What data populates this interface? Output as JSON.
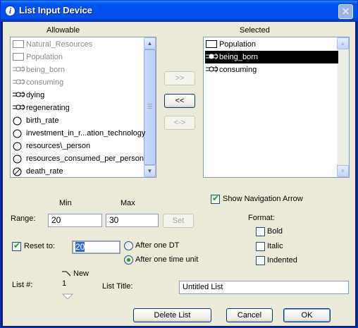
{
  "window": {
    "title": "List Input Device"
  },
  "allowable": {
    "header": "Allowable",
    "items": [
      {
        "label": "Natural_Resources",
        "icon": "stock-icon",
        "dimmed": true
      },
      {
        "label": "Population",
        "icon": "stock-icon",
        "dimmed": true
      },
      {
        "label": "being_born",
        "icon": "flow-icon",
        "dimmed": true
      },
      {
        "label": "consuming",
        "icon": "flow-icon",
        "dimmed": true
      },
      {
        "label": "dying",
        "icon": "flow-icon",
        "dimmed": false
      },
      {
        "label": "regenerating",
        "icon": "flow-icon",
        "dimmed": false
      },
      {
        "label": "birth_rate",
        "icon": "converter-icon",
        "dimmed": false
      },
      {
        "label": "investment_in_r...ation_technology",
        "icon": "converter-icon",
        "dimmed": false
      },
      {
        "label": "resources\\_person",
        "icon": "converter-icon",
        "dimmed": false
      },
      {
        "label": "resources_consumed_per_person",
        "icon": "converter-icon",
        "dimmed": false
      },
      {
        "label": "death_rate",
        "icon": "ghost-converter-icon",
        "dimmed": false
      }
    ]
  },
  "selected": {
    "header": "Selected",
    "items": [
      {
        "label": "Population",
        "icon": "stock-icon",
        "selected": false
      },
      {
        "label": "being_born",
        "icon": "flow-icon",
        "selected": true
      },
      {
        "label": "consuming",
        "icon": "flow-icon",
        "selected": false
      }
    ]
  },
  "transfer": {
    "add": ">>",
    "remove": "<<",
    "swap": "<->"
  },
  "range": {
    "label": "Range:",
    "min_label": "Min",
    "max_label": "Max",
    "min_value": "20",
    "max_value": "30",
    "set_label": "Set"
  },
  "reset": {
    "label": "Reset to:",
    "checked": true,
    "value": "20",
    "options": [
      {
        "label": "After one DT",
        "checked": false
      },
      {
        "label": "After one time unit",
        "checked": true
      }
    ]
  },
  "show_nav": {
    "label": "Show Navigation Arrow",
    "checked": true
  },
  "format": {
    "label": "Format:",
    "options": [
      {
        "label": "Bold",
        "checked": false
      },
      {
        "label": "Italic",
        "checked": false
      },
      {
        "label": "Indented",
        "checked": false
      }
    ]
  },
  "list_num": {
    "label": "List #:",
    "value": "1",
    "new_label": "New"
  },
  "list_title": {
    "label": "List Title:",
    "value": "Untitled List"
  },
  "buttons": {
    "delete": "Delete List",
    "cancel": "Cancel",
    "ok": "OK"
  },
  "colors": {
    "title_bar": "#0054e3",
    "selection": "#000000",
    "check_green": "#21a121",
    "dialog_bg": "#ece9d8"
  }
}
